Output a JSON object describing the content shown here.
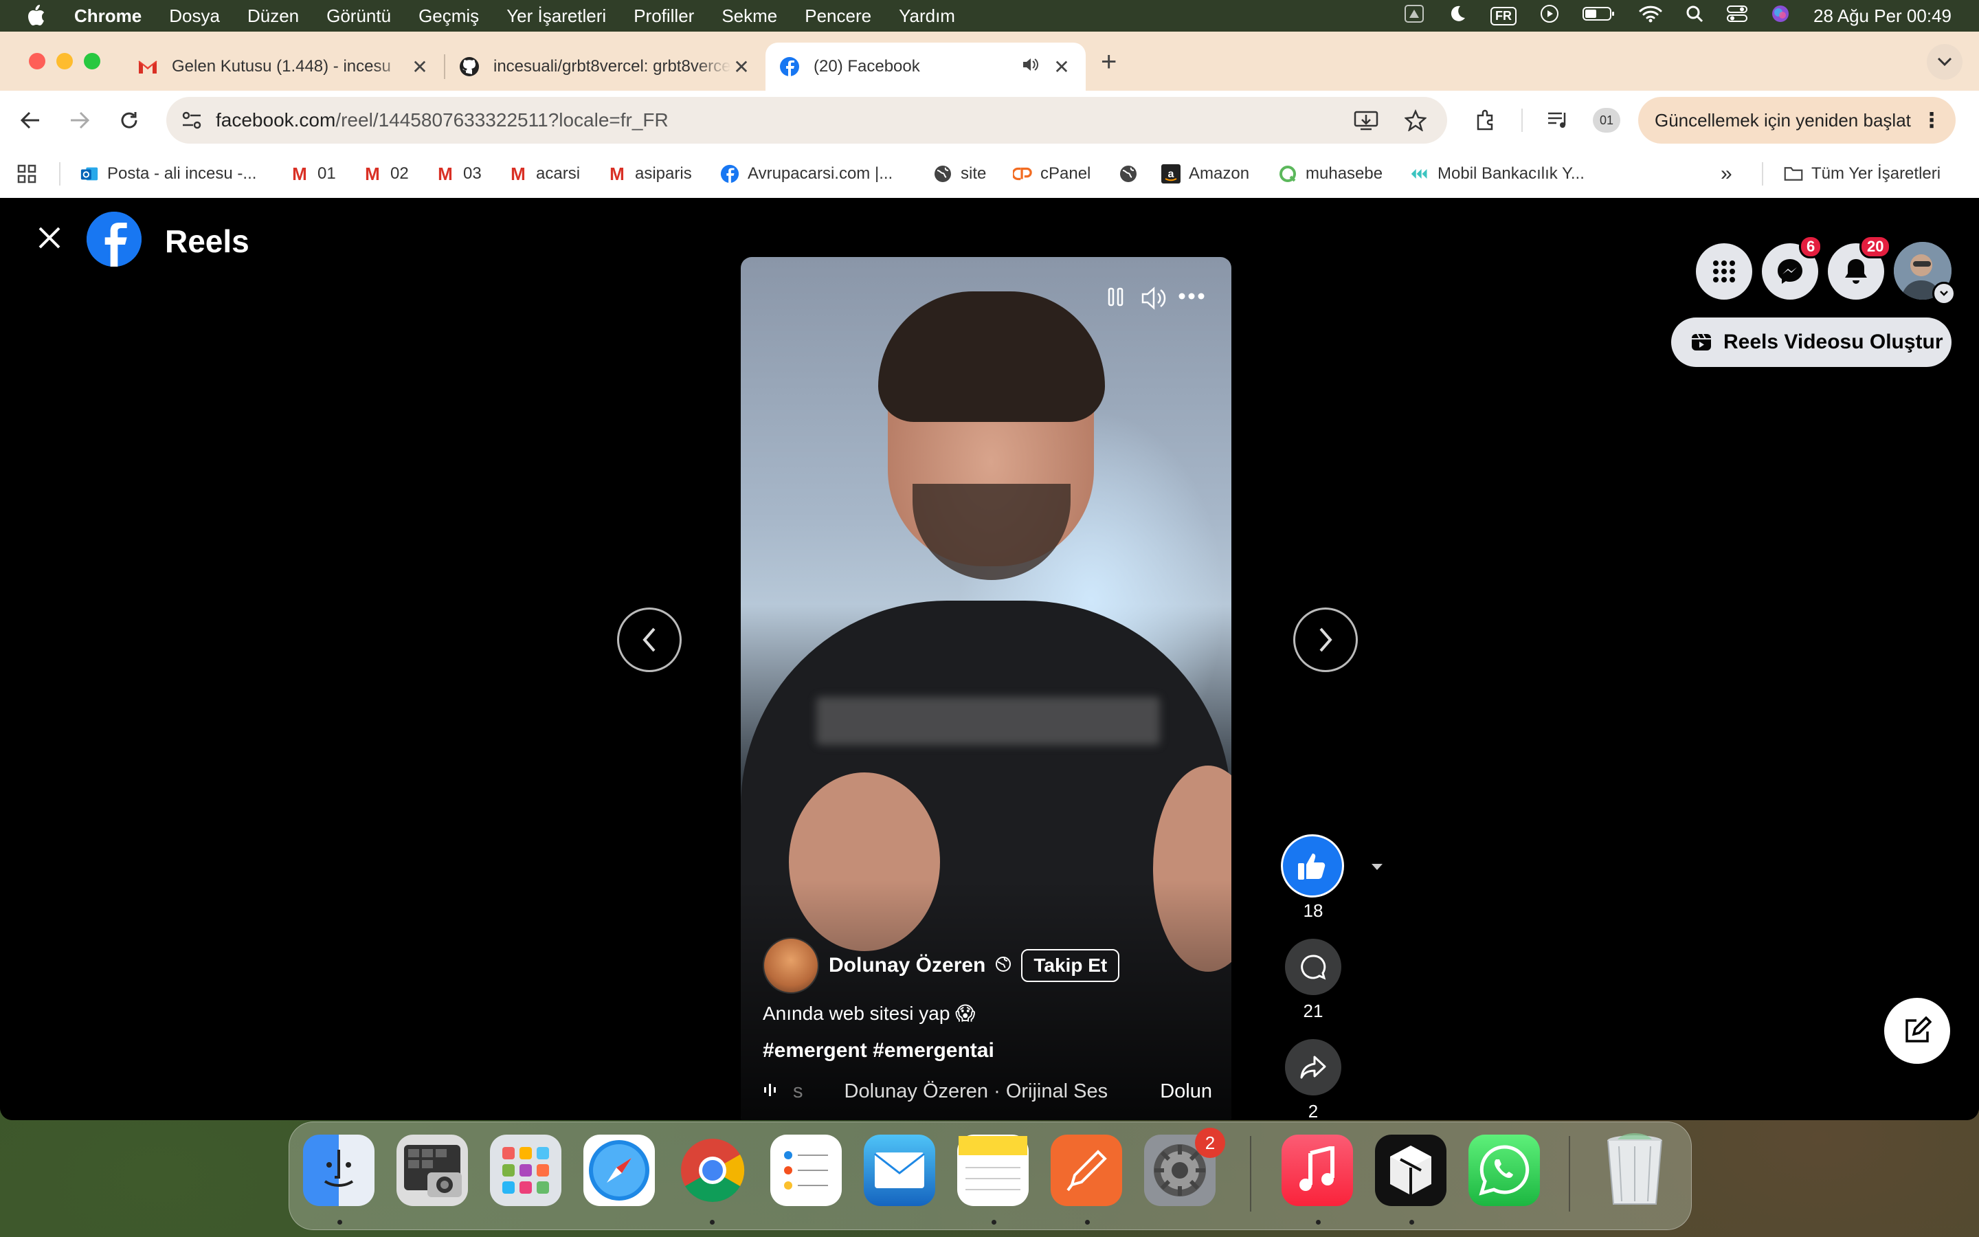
{
  "menubar": {
    "app_name": "Chrome",
    "items": [
      "Dosya",
      "Düzen",
      "Görüntü",
      "Geçmiş",
      "Yer İşaretleri",
      "Profiller",
      "Sekme",
      "Pencere",
      "Yardım"
    ],
    "input_source": "FR",
    "datetime": "28 Ağu Per  00:49"
  },
  "tabs": [
    {
      "title": "Gelen Kutusu (1.448) - incesu",
      "icon": "gmail-icon"
    },
    {
      "title": "incesuali/grbt8vercel: grbt8vercel",
      "icon": "github-icon"
    },
    {
      "title": "(20) Facebook",
      "icon": "facebook-icon",
      "active": true,
      "audio": true
    }
  ],
  "toolbar": {
    "url_host": "facebook.com",
    "url_path": "/reel/1445807633322511?locale=fr_FR",
    "profile_label": "01",
    "update_label": "Güncellemek için yeniden başlat"
  },
  "bookmarks": [
    {
      "label": "Posta - ali incesu -...",
      "icon": "outlook-icon"
    },
    {
      "label": "01",
      "icon": "gmail-icon"
    },
    {
      "label": "02",
      "icon": "gmail-icon"
    },
    {
      "label": "03",
      "icon": "gmail-icon"
    },
    {
      "label": "acarsi",
      "icon": "gmail-icon"
    },
    {
      "label": "asiparis",
      "icon": "gmail-icon"
    },
    {
      "label": "Avrupacarsi.com |...",
      "icon": "facebook-icon"
    },
    {
      "label": "site",
      "icon": "globe-icon"
    },
    {
      "label": "cPanel",
      "icon": "cpanel-icon"
    },
    {
      "label": "",
      "icon": "globe-icon"
    },
    {
      "label": "Amazon",
      "icon": "amazon-icon"
    },
    {
      "label": "muhasebe",
      "icon": "leaf-icon"
    },
    {
      "label": "Mobil Bankacılık Y...",
      "icon": "bank-icon"
    }
  ],
  "bookmarks_overflow": "»",
  "all_bookmarks_label": "Tüm Yer İşaretleri",
  "reels": {
    "title": "Reels",
    "messenger_badge": "6",
    "notifications_badge": "20",
    "create_label": "Reels Videosu Oluştur",
    "author": "Dolunay Özeren",
    "follow_label": "Takip Et",
    "caption": "Anında web sitesi yap 😱",
    "hashtags": "#emergent #emergentai",
    "audio_prefix": "s",
    "audio_label": "Dolunay Özeren · Orijinal Ses",
    "audio_trail": "Dolun",
    "likes": "18",
    "comments": "21",
    "shares": "2"
  },
  "dock": {
    "apps": [
      "finder",
      "image-capture",
      "launchpad",
      "safari",
      "chrome",
      "reminders",
      "mail",
      "notes",
      "paw",
      "system-settings",
      "music",
      "cube-app",
      "whatsapp",
      "trash"
    ],
    "settings_badge": "2"
  },
  "colors": {
    "facebook_blue": "#1877f2",
    "tabbar_bg": "#f6e3cf",
    "badge_red": "#e41e3f"
  }
}
